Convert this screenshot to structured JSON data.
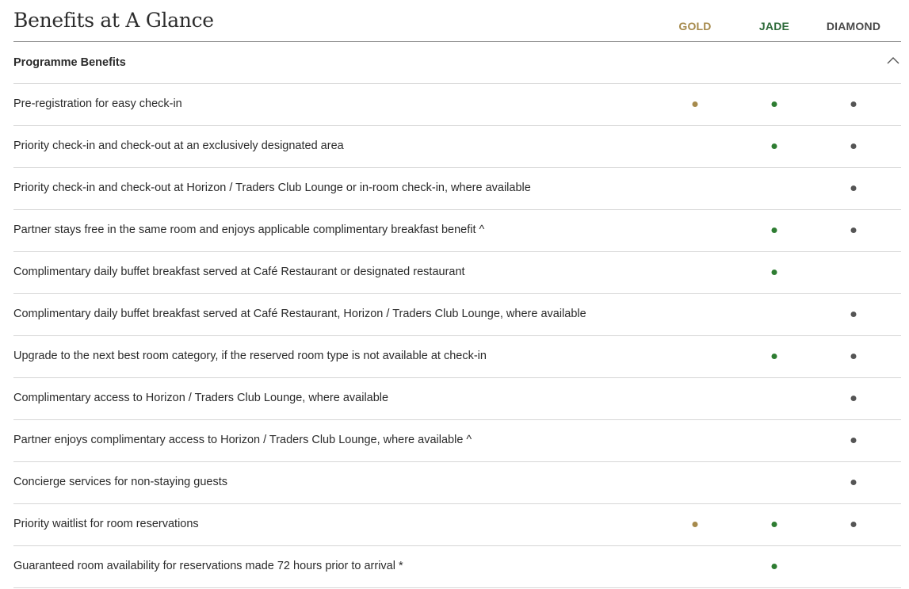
{
  "header": {
    "title": "Benefits at A Glance",
    "tiers": [
      {
        "name": "GOLD",
        "color": "#a68a4c"
      },
      {
        "name": "JADE",
        "color": "#2e6b3a"
      },
      {
        "name": "DIAMOND",
        "color": "#4a4a4a"
      }
    ]
  },
  "section": {
    "title": "Programme Benefits",
    "collapse_icon": "chevron-up-icon"
  },
  "dot_colors": {
    "gold": "#a68a4c",
    "jade": "#2e7d32",
    "diamond": "#555555"
  },
  "benefits": [
    {
      "label": "Pre-registration for easy check-in",
      "gold": true,
      "jade": true,
      "diamond": true
    },
    {
      "label": "Priority check-in and check-out at an exclusively designated area",
      "gold": false,
      "jade": true,
      "diamond": true
    },
    {
      "label": "Priority check-in and check-out at Horizon / Traders Club Lounge or in-room check-in, where available",
      "gold": false,
      "jade": false,
      "diamond": true
    },
    {
      "label": "Partner stays free in the same room and enjoys applicable complimentary breakfast benefit ^",
      "gold": false,
      "jade": true,
      "diamond": true
    },
    {
      "label": "Complimentary daily buffet breakfast served at Café Restaurant or designated restaurant",
      "gold": false,
      "jade": true,
      "diamond": false
    },
    {
      "label": "Complimentary daily buffet breakfast served at Café Restaurant, Horizon / Traders Club Lounge, where available",
      "gold": false,
      "jade": false,
      "diamond": true
    },
    {
      "label": "Upgrade to the next best room category, if the reserved room type is not available at check-in",
      "gold": false,
      "jade": true,
      "diamond": true
    },
    {
      "label": "Complimentary access to Horizon / Traders Club Lounge, where available",
      "gold": false,
      "jade": false,
      "diamond": true
    },
    {
      "label": "Partner enjoys complimentary access to Horizon / Traders Club Lounge, where available ^",
      "gold": false,
      "jade": false,
      "diamond": true
    },
    {
      "label": "Concierge services for non-staying guests",
      "gold": false,
      "jade": false,
      "diamond": true
    },
    {
      "label": "Priority waitlist for room reservations",
      "gold": true,
      "jade": true,
      "diamond": true
    },
    {
      "label": "Guaranteed room availability for reservations made 72 hours prior to arrival *",
      "gold": false,
      "jade": true,
      "diamond": false
    }
  ]
}
